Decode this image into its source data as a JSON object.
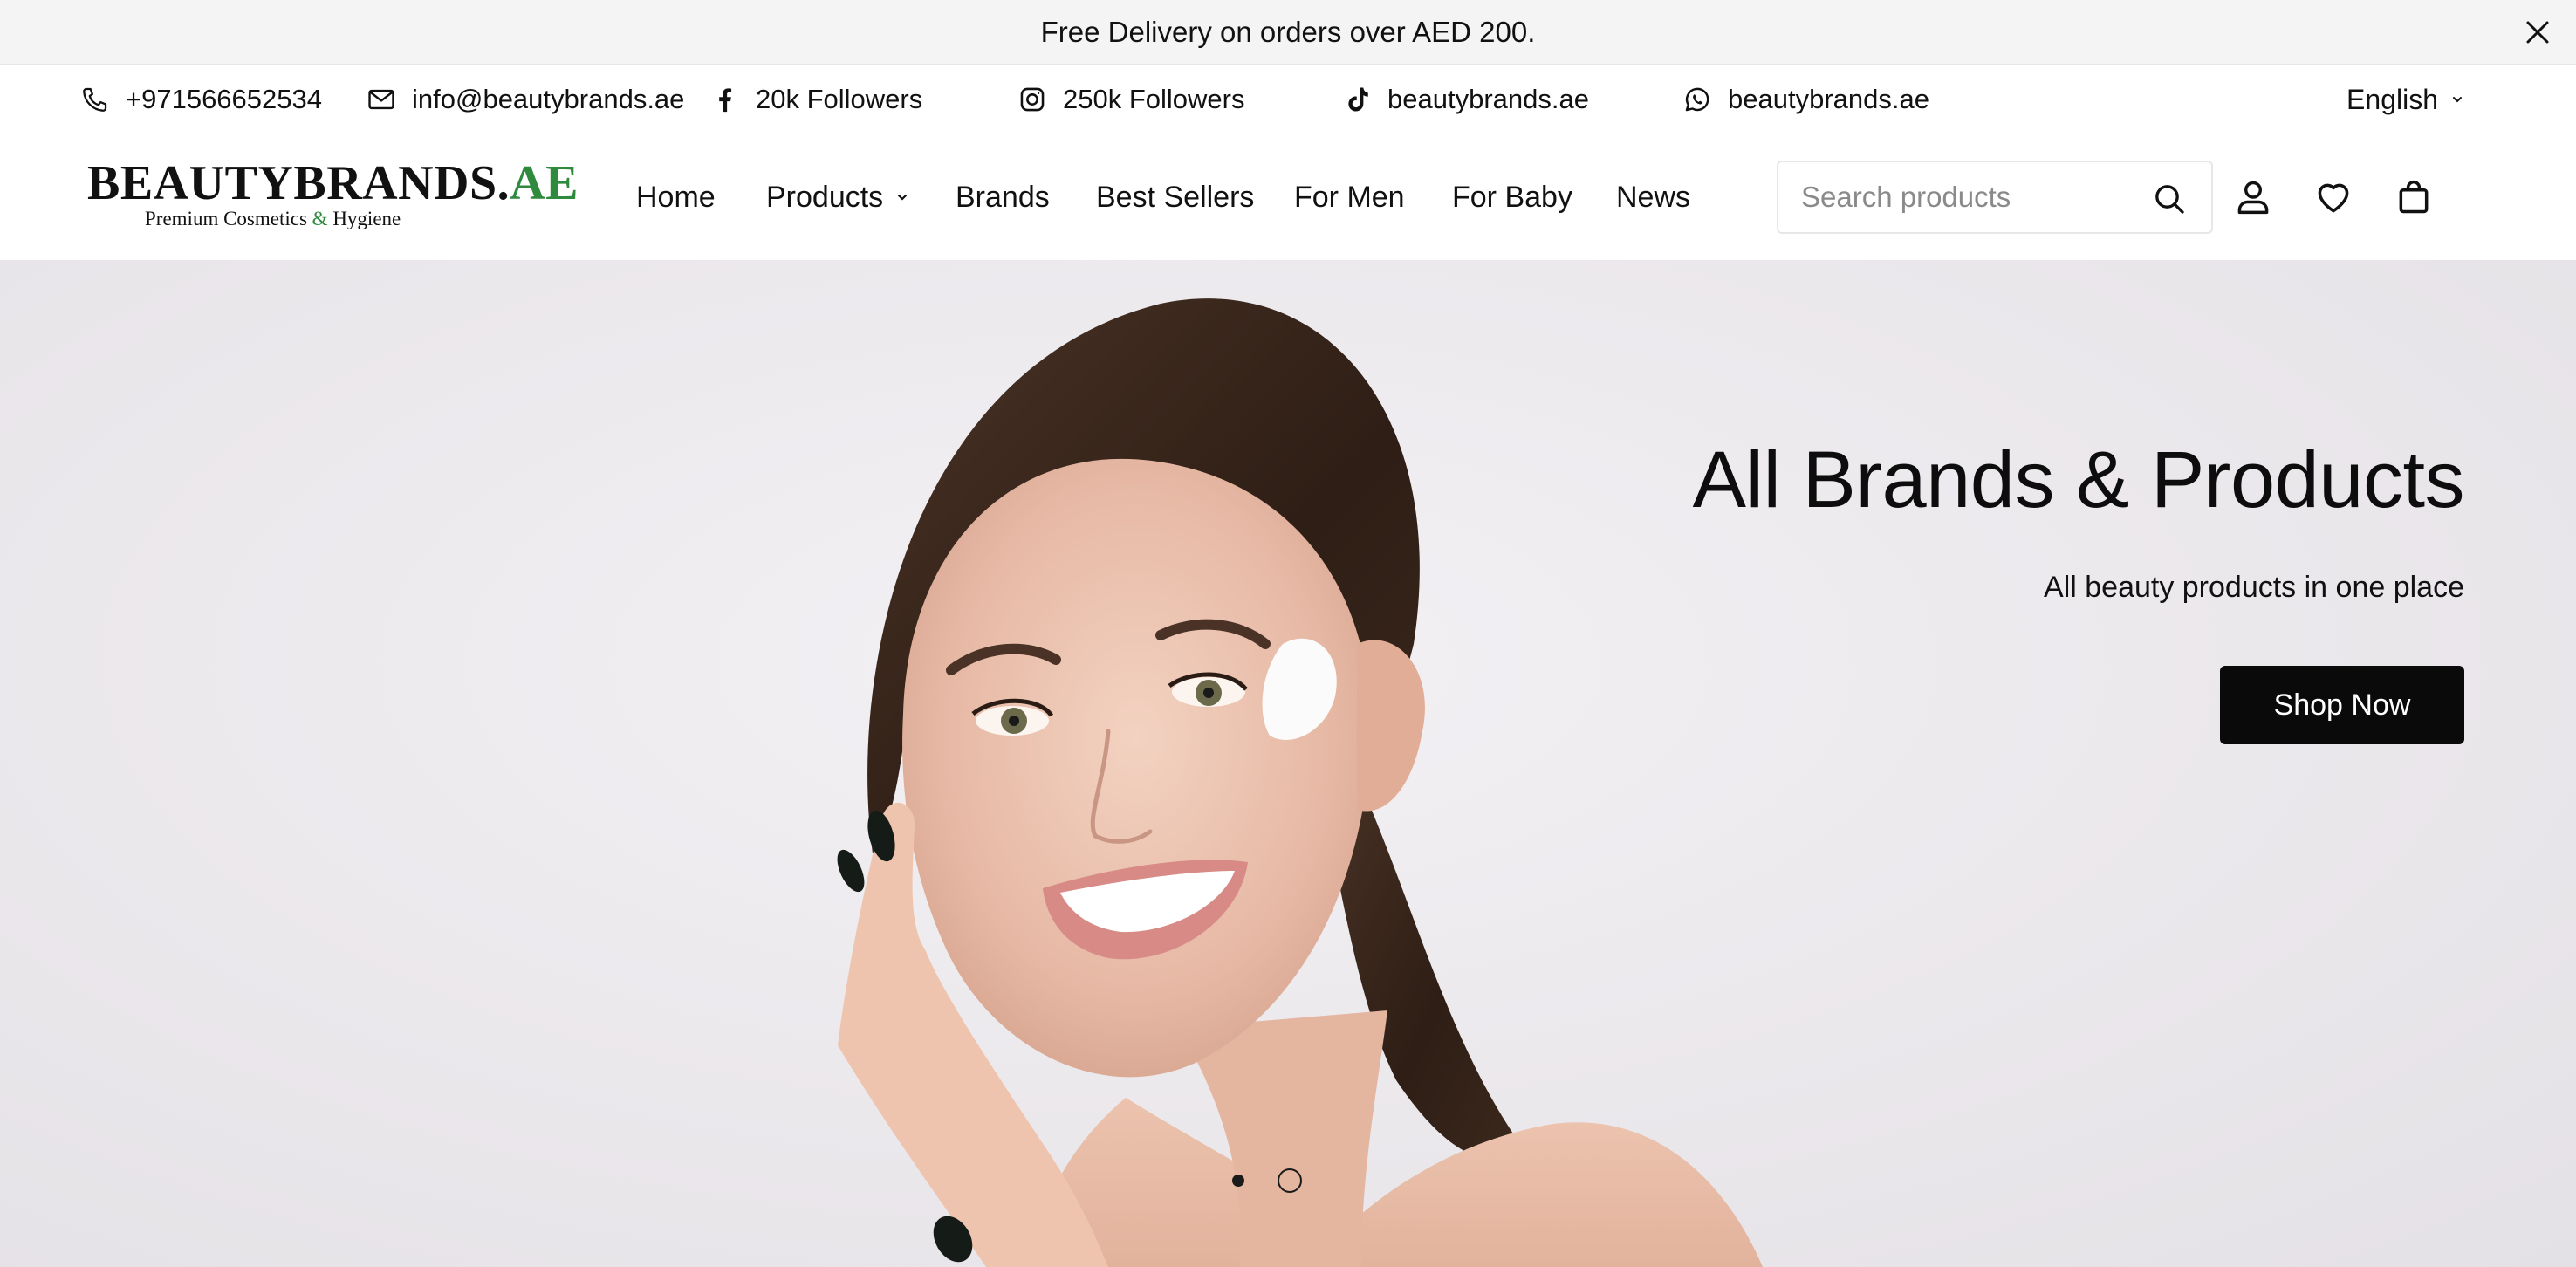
{
  "announcement": {
    "text": "Free Delivery on orders over AED 200.",
    "close_icon": "close-icon"
  },
  "contact_bar": {
    "phone": {
      "icon": "phone-icon",
      "label": "+971566652534"
    },
    "email": {
      "icon": "mail-icon",
      "label": "info@beautybrands.ae"
    },
    "facebook": {
      "icon": "facebook-icon",
      "label": "20k Followers"
    },
    "instagram": {
      "icon": "instagram-icon",
      "label": "250k Followers"
    },
    "tiktok": {
      "icon": "tiktok-icon",
      "label": "beautybrands.ae"
    },
    "whatsapp": {
      "icon": "whatsapp-icon",
      "label": "beautybrands.ae"
    },
    "language": {
      "label": "English",
      "icon": "chevron-down-icon"
    }
  },
  "header": {
    "logo": {
      "main": "BEAUTYBRANDS.",
      "main_accent": "AE",
      "sub_before": "Premium Cosmetics ",
      "sub_amp": "&",
      "sub_after": " Hygiene",
      "accent_color": "#2f8a3e"
    },
    "nav": {
      "home": "Home",
      "products": "Products",
      "brands": "Brands",
      "best_sellers": "Best Sellers",
      "for_men": "For Men",
      "for_baby": "For Baby",
      "news": "News"
    },
    "search": {
      "placeholder": "Search products",
      "value": "",
      "icon": "search-icon"
    },
    "icons": [
      "user-icon",
      "heart-icon",
      "cart-icon"
    ]
  },
  "hero": {
    "title": "All Brands & Products",
    "subtitle": "All beauty products in one place",
    "cta": "Shop Now",
    "slides_total": 2,
    "active_slide": 1,
    "cta_color": "#0a0a0a"
  }
}
